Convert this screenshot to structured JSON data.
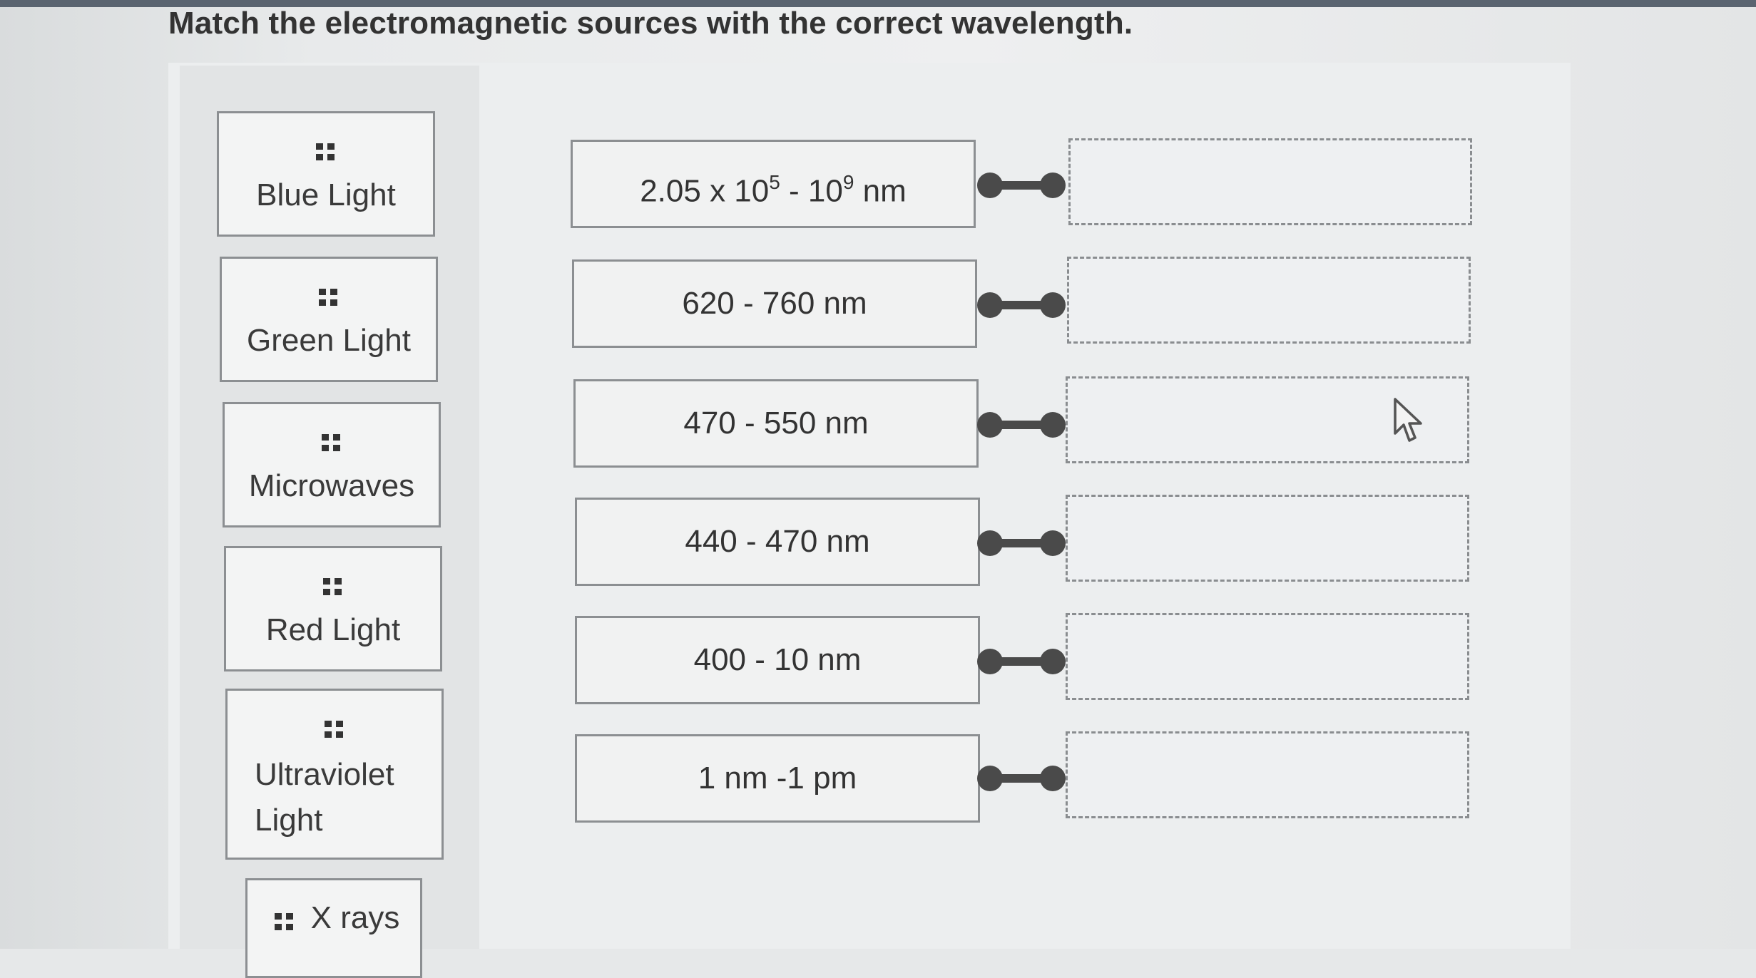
{
  "question": "Match the electromagnetic sources with the correct wavelength.",
  "sources": [
    {
      "label": "Blue Light"
    },
    {
      "label": "Green Light"
    },
    {
      "label": "Microwaves"
    },
    {
      "label": "Red Light"
    },
    {
      "label": "Ultraviolet Light"
    },
    {
      "label": "X rays"
    }
  ],
  "wavelengths": [
    {
      "base": "2.05 x 10",
      "exp1": "5",
      "mid": " - 10",
      "exp2": "9",
      "unit": " nm"
    },
    {
      "label": "620 - 760 nm"
    },
    {
      "label": "470 - 550 nm"
    },
    {
      "label": "440 - 470 nm"
    },
    {
      "label": "400 - 10 nm"
    },
    {
      "label": "1 nm -1 pm"
    }
  ]
}
